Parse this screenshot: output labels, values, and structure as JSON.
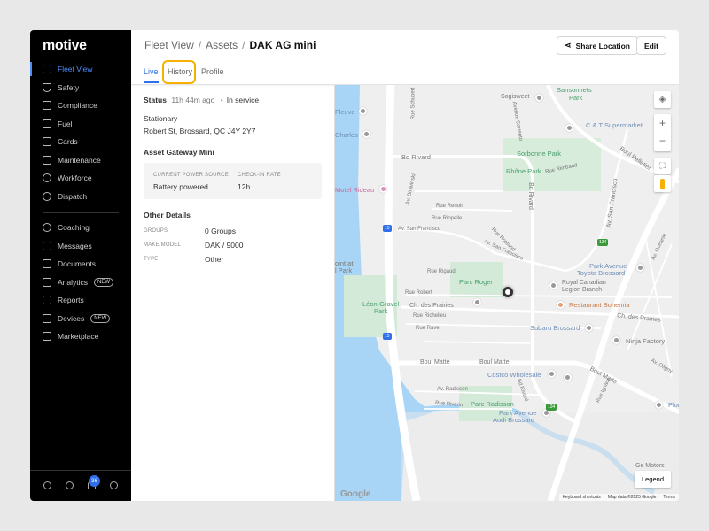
{
  "brand": "motive",
  "sidebar": {
    "items": [
      {
        "label": "Fleet View"
      },
      {
        "label": "Safety"
      },
      {
        "label": "Compliance"
      },
      {
        "label": "Fuel"
      },
      {
        "label": "Cards"
      },
      {
        "label": "Maintenance"
      },
      {
        "label": "Workforce"
      },
      {
        "label": "Dispatch"
      },
      {
        "label": "Coaching"
      },
      {
        "label": "Messages"
      },
      {
        "label": "Documents"
      },
      {
        "label": "Analytics",
        "badge": "NEW"
      },
      {
        "label": "Reports"
      },
      {
        "label": "Devices",
        "badge": "NEW"
      },
      {
        "label": "Marketplace"
      }
    ],
    "notification_count": "36"
  },
  "header": {
    "breadcrumb": [
      "Fleet View",
      "Assets",
      "DAK AG mini"
    ],
    "share_label": "Share Location",
    "edit_label": "Edit",
    "tabs": [
      "Live",
      "History",
      "Profile"
    ]
  },
  "details": {
    "status_label": "Status",
    "status_time": "11h 44m ago",
    "status_value": "In service",
    "state": "Stationary",
    "address": "Robert St, Brossard, QC J4Y 2Y7",
    "gateway_title": "Asset Gateway Mini",
    "power_label": "CURRENT POWER SOURCE",
    "power_value": "Battery powered",
    "checkin_label": "CHECK-IN RATE",
    "checkin_value": "12h",
    "other_title": "Other Details",
    "groups_label": "GROUPS",
    "groups_value": "0 Groups",
    "model_label": "MAKE/MODEL",
    "model_value": "DAK / 9000",
    "type_label": "TYPE",
    "type_value": "Other"
  },
  "map": {
    "labels": [
      "Sansonnets",
      "Park",
      "Sogisweet",
      "Fleuve",
      "Charles",
      "Rue Schubert",
      "Avenue Sorrento",
      "C & T Supermarket",
      "Bd Rivard",
      "Sorbonne Park",
      "Boul Pelletier",
      "Rhône Park",
      "Rue Rimbaud",
      "Av. Stravinski",
      "Motel Rideau",
      "Bd Rivard",
      "Av. San Francisco",
      "Rue Renoir",
      "Rue Riopelle",
      "Av. San Francisco",
      "Rue Rostand",
      "Av. San Francisco",
      "Av. Océanie",
      "oint at",
      "l Park",
      "Rue Rigaud",
      "Parc Roger",
      "Park Avenue",
      "Toyota Brossard",
      "Royal Canadian",
      "Legion Branch",
      "Rue Robert",
      "Léon-Gravel",
      "Park",
      "Ch. des Prairies",
      "Restaurant Bohemia",
      "Rue Richelieu",
      "Ch. des Prairies",
      "Rue Ravel",
      "Subaru Brossard",
      "Ninja Factory",
      "Boul Matte",
      "Boul Matte",
      "Costco Wholesale",
      "Boul Matte",
      "Bd Rivard",
      "Av. Radisson",
      "Rue Riverin",
      "Parc Radisson",
      "Park Avenue",
      "Audi Brossard",
      "Rue Ignace",
      "Ge Motors",
      "Plon",
      "Av. Oligny"
    ],
    "highway_15": "15",
    "highway_134": "134",
    "google": "Google",
    "legend": "Legend",
    "shortcuts": "Keyboard shortcuts",
    "mapdata": "Map data ©2025 Google",
    "terms": "Terms"
  }
}
